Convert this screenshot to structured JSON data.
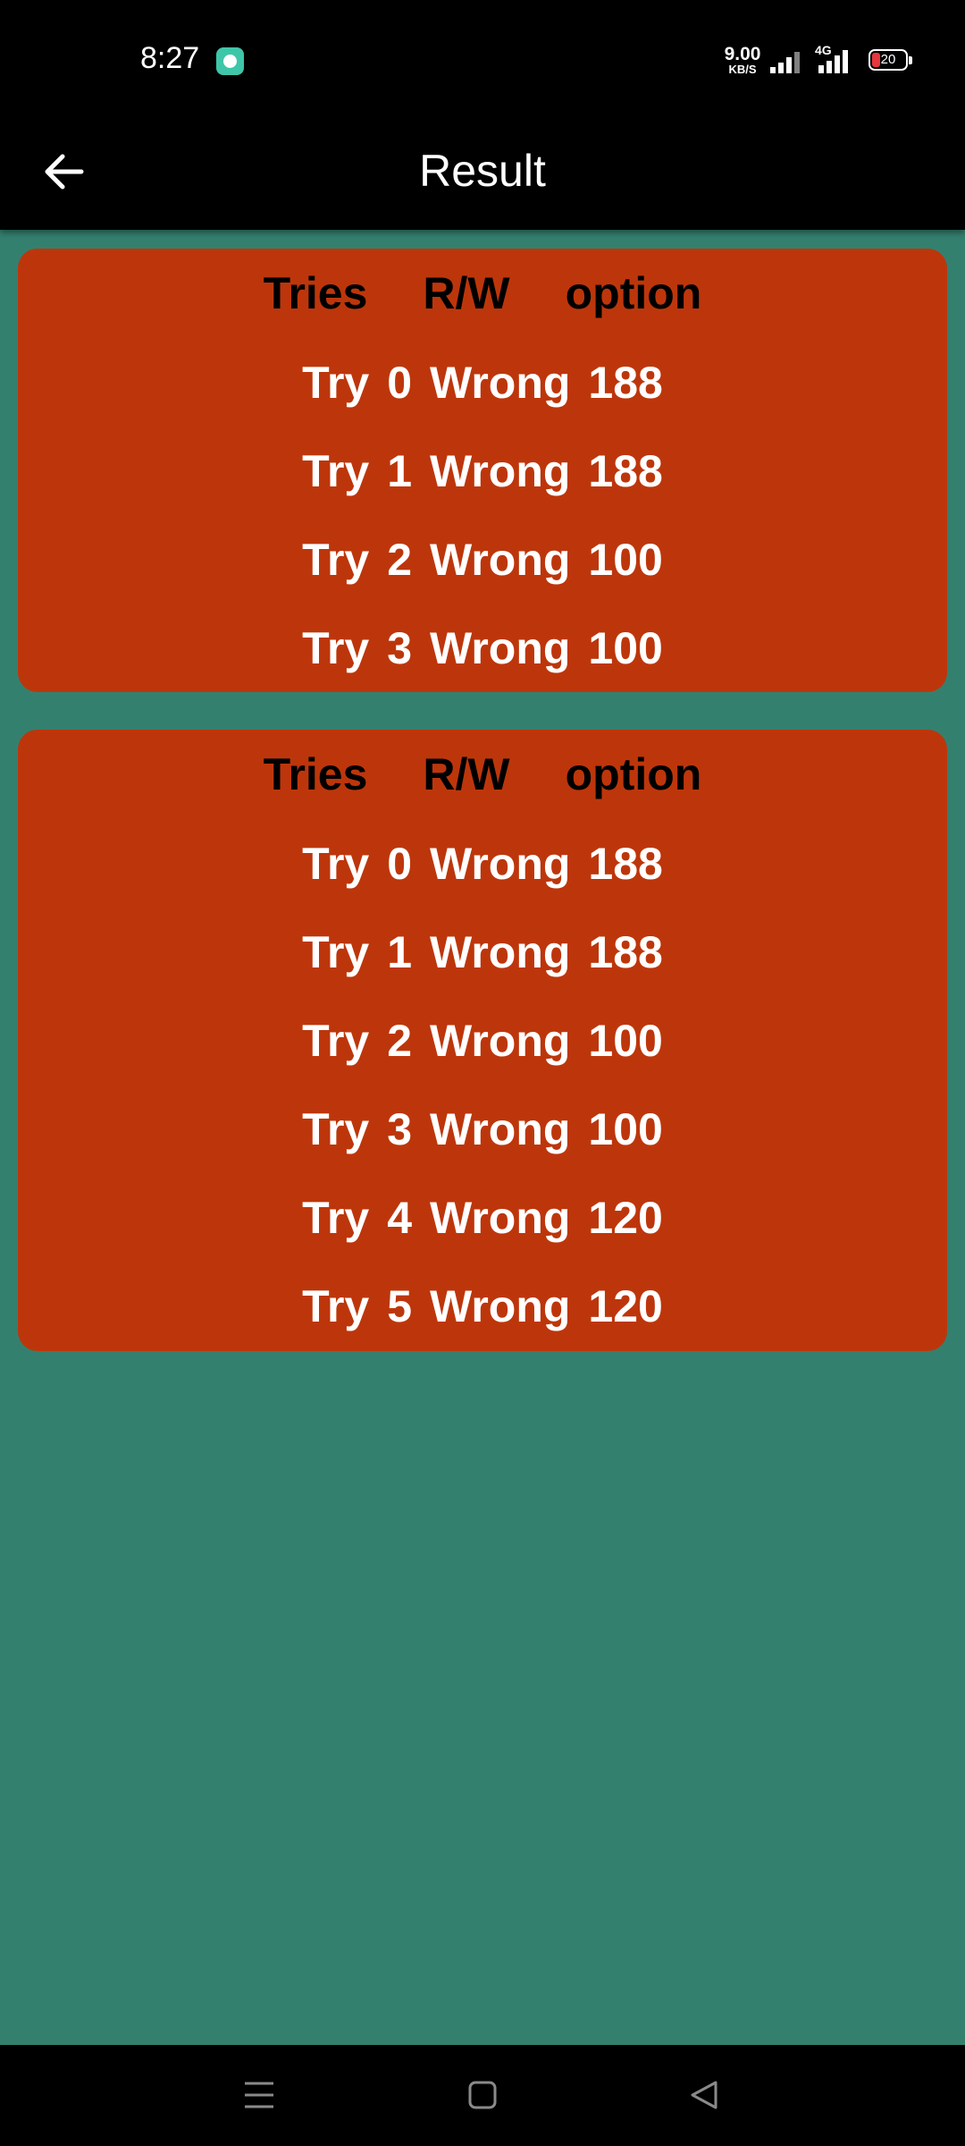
{
  "status_bar": {
    "time": "8:27",
    "net_speed_value": "9.00",
    "net_speed_unit": "KB/S",
    "network_type": "4G",
    "battery_level": "20"
  },
  "app_bar": {
    "title": "Result",
    "back_icon": "arrow-left-icon"
  },
  "cards": [
    {
      "header": [
        "Tries",
        "R/W",
        "option"
      ],
      "rows": [
        [
          "Try",
          "0",
          "Wrong",
          "188"
        ],
        [
          "Try",
          "1",
          "Wrong",
          "188"
        ],
        [
          "Try",
          "2",
          "Wrong",
          "100"
        ],
        [
          "Try",
          "3",
          "Wrong",
          "100"
        ]
      ]
    },
    {
      "header": [
        "Tries",
        "R/W",
        "option"
      ],
      "rows": [
        [
          "Try",
          "0",
          "Wrong",
          "188"
        ],
        [
          "Try",
          "1",
          "Wrong",
          "188"
        ],
        [
          "Try",
          "2",
          "Wrong",
          "100"
        ],
        [
          "Try",
          "3",
          "Wrong",
          "100"
        ],
        [
          "Try",
          "4",
          "Wrong",
          "120"
        ],
        [
          "Try",
          "5",
          "Wrong",
          "120"
        ]
      ]
    }
  ],
  "nav_bar": {
    "icons": [
      "menu-icon",
      "home-icon",
      "back-triangle-icon"
    ]
  },
  "colors": {
    "background": "#34806f",
    "card": "#bd360b",
    "header_text": "#000000",
    "row_text": "#ffffff",
    "bars": "#000000"
  }
}
